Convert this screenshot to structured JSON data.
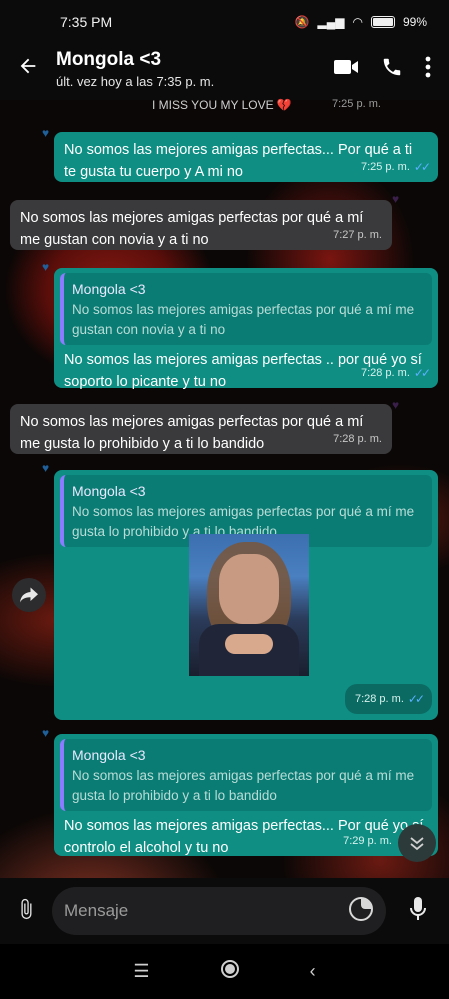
{
  "status_bar": {
    "time": "7:35 PM",
    "battery": "99"
  },
  "header": {
    "contact_name": "Mongola <3",
    "last_seen": "últ. vez hoy a las 7:35 p. m."
  },
  "messages": {
    "partial_top": {
      "text": "I MISS YOU  MY LOVE 💔",
      "time": "7:25 p. m."
    },
    "m1": {
      "text": "No somos las mejores amigas perfectas... Por qué a ti te gusta tu cuerpo y A mi no",
      "time": "7:25 p. m."
    },
    "m2": {
      "text": "No somos las mejores amigas perfectas por qué a mí me gustan con novia y a ti no",
      "time": "7:27 p. m."
    },
    "m3": {
      "quote_name": "Mongola <3",
      "quote_text": "No somos las mejores amigas perfectas por qué a mí me gustan con novia y a ti no",
      "text": "No somos las mejores amigas perfectas .. por qué yo sí soporto lo picante y tu no",
      "time": "7:28 p. m."
    },
    "m4": {
      "text": "No somos las mejores amigas perfectas por qué a mí me gusta lo prohibido y a ti lo bandido",
      "time": "7:28 p. m."
    },
    "m5": {
      "quote_name": "Mongola <3",
      "quote_text": "No somos las mejores amigas perfectas por qué a mí me gusta lo prohibido y a ti lo bandido",
      "time": "7:28 p. m."
    },
    "m6": {
      "quote_name": "Mongola <3",
      "quote_text": "No somos las mejores amigas perfectas por qué a mí me gusta lo prohibido y a ti lo bandido",
      "text": "No somos las mejores amigas perfectas... Por qué yo sí controlo el alcohol y tu no",
      "time": "7:29 p. m."
    }
  },
  "input": {
    "placeholder": "Mensaje"
  }
}
